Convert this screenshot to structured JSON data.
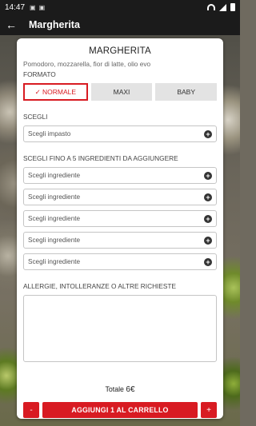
{
  "status": {
    "time": "14:47"
  },
  "appbar": {
    "title": "Margherita",
    "back_icon": "arrow-left-icon"
  },
  "product": {
    "name": "MARGHERITA",
    "description": "Pomodoro, mozzarella, fior di latte, olio evo"
  },
  "formato": {
    "label": "FORMATO",
    "options": [
      {
        "label": "✓ NORMALE",
        "selected": true
      },
      {
        "label": "MAXI",
        "selected": false
      },
      {
        "label": "BABY",
        "selected": false
      }
    ]
  },
  "scegli": {
    "label": "SCEGLI",
    "placeholder": "Scegli impasto"
  },
  "ingredienti": {
    "label": "SCEGLI FINO A 5 INGREDIENTI DA AGGIUNGERE",
    "items": [
      "Scegli ingrediente",
      "Scegli ingrediente",
      "Scegli ingrediente",
      "Scegli ingrediente",
      "Scegli ingrediente"
    ]
  },
  "allergie": {
    "label": "ALLERGIE, INTOLLERANZE O ALTRE RICHIESTE"
  },
  "totale": {
    "label": "Totale",
    "price": "6€"
  },
  "actions": {
    "minus": "-",
    "add_to_cart": "AGGIUNGI 1 AL CARRELLO",
    "plus": "+"
  },
  "colors": {
    "accent": "#d81b22",
    "bar": "#1b1b1b"
  }
}
